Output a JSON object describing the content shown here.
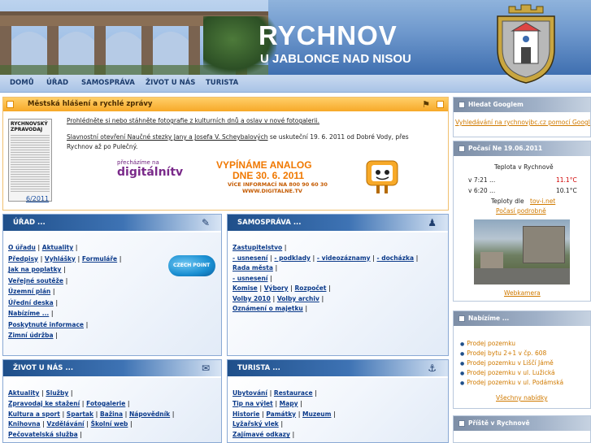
{
  "header": {
    "title": "RYCHNOV",
    "subtitle": "U JABLONCE NAD NISOU"
  },
  "nav": [
    "DOMŮ",
    "ÚŘAD",
    "SAMOSPRÁVA",
    "ŽIVOT U NÁS",
    "TURISTA"
  ],
  "news": {
    "title": "Městská hlášení a rychlé zprávy",
    "item1": "Prohlédněte si nebo stáhněte fotografie z kulturních dnů a oslav v nové fotogalerii.",
    "item2_link": "Slavnostní otevření Naučné stezky Jany a Josefa V. Scheybalových",
    "item2_rest": " se uskuteční 19. 6. 2011 od Dobré Vody, přes",
    "item2_line2": "Rychnov až po Pulečný.",
    "newspaper_title": "RYCHNOVSKÝ ZPRAVODAJ",
    "newspaper_date": "6/2011",
    "dtv_small": "přecházíme na",
    "dtv_big": "digitálnítv",
    "banner_l1": "VYPÍNÁME ANALOG",
    "banner_l2": "DNE  30. 6. 2011",
    "banner_l3": "VÍCE INFORMACÍ NA 800 90 60 30",
    "banner_l4": "WWW.DIGITALNE.TV"
  },
  "urad": {
    "title": "ÚŘAD ...",
    "rows": [
      [
        "O úřadu",
        "Aktuality"
      ],
      [
        "Předpisy",
        "Vyhlášky",
        "Formuláře"
      ],
      [
        "Jak na poplatky"
      ],
      [
        "Veřejné soutěže"
      ],
      [
        "Územní plán"
      ],
      [
        "Úřední deska"
      ],
      [
        "Nabízíme ..."
      ],
      [
        "Poskytnuté informace"
      ],
      [
        "Zimní údržba"
      ]
    ],
    "czechpoint": "CZECH POINT"
  },
  "samosprava": {
    "title": "SAMOSPRÁVA ...",
    "rows": [
      [
        "Zastupitelstvo"
      ],
      [
        "- usnesení",
        "- podklady",
        "- videozáznamy",
        "- docházka"
      ],
      [
        "Rada města"
      ],
      [
        "- usnesení"
      ],
      [
        "Komise",
        "Výbory",
        "Rozpočet"
      ],
      [
        "Volby 2010",
        "Volby archiv"
      ],
      [
        "Oznámení o majetku"
      ]
    ]
  },
  "zivot": {
    "title": "ŽIVOT U NÁS ...",
    "rows": [
      [
        "Aktuality",
        "Služby"
      ],
      [
        "Zpravodaj ke stažení",
        "Fotogalerie"
      ],
      [
        "Kultura a sport",
        "Spartak",
        "Bažina",
        "Nápovědník"
      ],
      [
        "Knihovna",
        "Vzdělávání",
        "Školní web"
      ],
      [
        "Pečovatelská služba"
      ]
    ]
  },
  "turista": {
    "title": "TURISTA ...",
    "rows": [
      [
        "Ubytování",
        "Restaurace"
      ],
      [
        "Tip na výlet",
        "Mapy"
      ],
      [
        "Historie",
        "Památky",
        "Muzeum"
      ],
      [
        "Lyžařský vlek"
      ],
      [
        "Zajímavé odkazy"
      ]
    ]
  },
  "right": {
    "google_title": "Hledat Googlem",
    "google_link": "Vyhledávání na rychnovjbc.cz pomocí Google",
    "weather_title": "Počasí Ne 19.06.2011",
    "weather_place": "Teplota v Rychnově",
    "w1_time": "v 7:21 ...",
    "w1_temp": "11.1°C",
    "w2_time": "v 6:20 ...",
    "w2_temp": "10.1°C",
    "w_source_text": "Teploty dle",
    "w_source_link": "tov-i.net",
    "w_forecast": "Počasí podrobně",
    "webcam": "Webkamera",
    "offer_title": "Nabízíme ...",
    "offers": [
      "Prodej pozemku",
      "Prodej bytu 2+1 v čp. 608",
      "Prodej pozemku v Liščí Jámě",
      "Prodej pozemku v ul. Lužická",
      "Prodej pozemku v ul. Podámská"
    ],
    "offers_all": "Všechny nabídky",
    "next_title": "Příště v Rychnově"
  }
}
